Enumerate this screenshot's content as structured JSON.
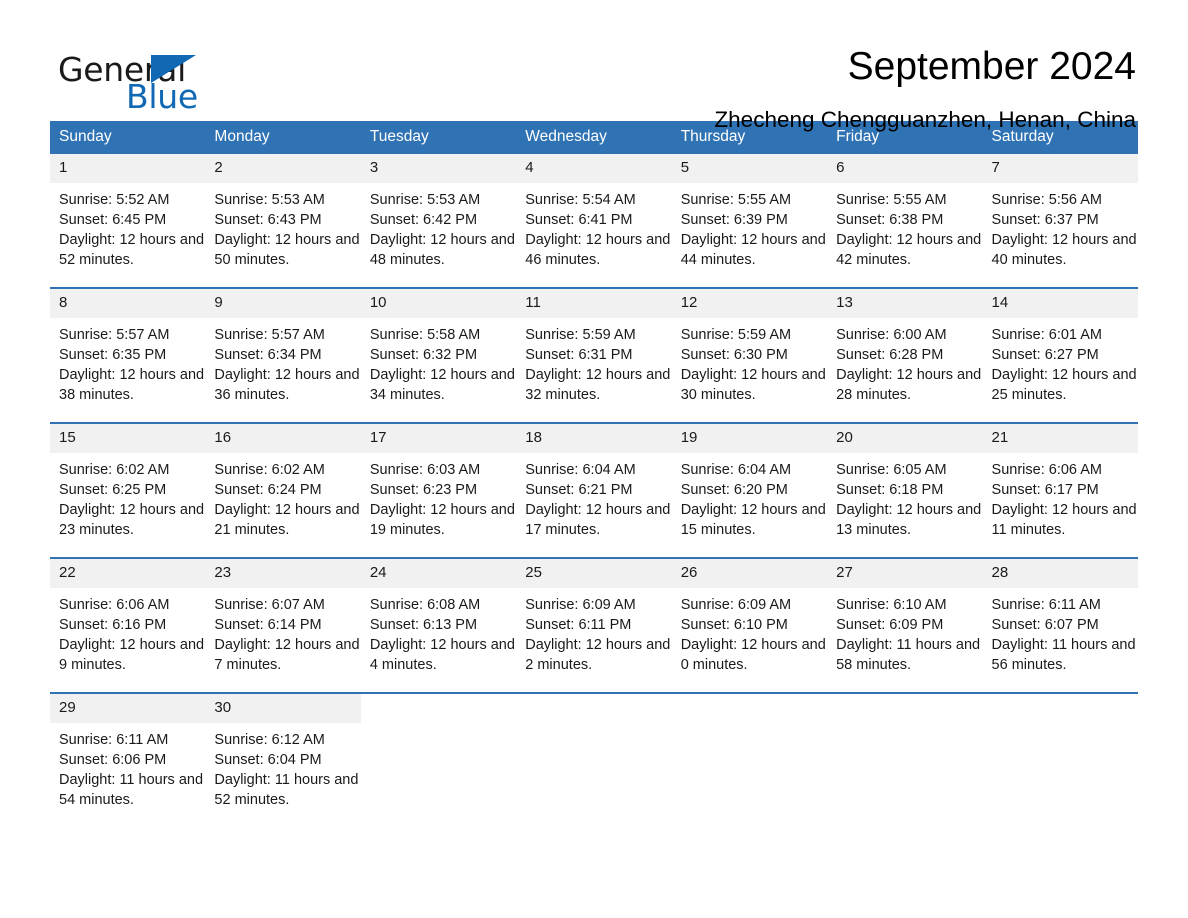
{
  "brand": {
    "name_part1": "General",
    "name_part2": "Blue",
    "accent_color": "#1168b3"
  },
  "header": {
    "title": "September 2024",
    "subtitle": "Zhecheng Chengguanzhen, Henan, China",
    "header_bg": "#3073b4",
    "daynum_bg": "#f1f1f1"
  },
  "weekdays": [
    "Sunday",
    "Monday",
    "Tuesday",
    "Wednesday",
    "Thursday",
    "Friday",
    "Saturday"
  ],
  "labels": {
    "sunrise_prefix": "Sunrise:",
    "sunset_prefix": "Sunset:",
    "daylight_prefix": "Daylight:"
  },
  "weeks": [
    [
      {
        "day": "1",
        "sunrise": "Sunrise: 5:52 AM",
        "sunset": "Sunset: 6:45 PM",
        "daylight": "Daylight: 12 hours and 52 minutes."
      },
      {
        "day": "2",
        "sunrise": "Sunrise: 5:53 AM",
        "sunset": "Sunset: 6:43 PM",
        "daylight": "Daylight: 12 hours and 50 minutes."
      },
      {
        "day": "3",
        "sunrise": "Sunrise: 5:53 AM",
        "sunset": "Sunset: 6:42 PM",
        "daylight": "Daylight: 12 hours and 48 minutes."
      },
      {
        "day": "4",
        "sunrise": "Sunrise: 5:54 AM",
        "sunset": "Sunset: 6:41 PM",
        "daylight": "Daylight: 12 hours and 46 minutes."
      },
      {
        "day": "5",
        "sunrise": "Sunrise: 5:55 AM",
        "sunset": "Sunset: 6:39 PM",
        "daylight": "Daylight: 12 hours and 44 minutes."
      },
      {
        "day": "6",
        "sunrise": "Sunrise: 5:55 AM",
        "sunset": "Sunset: 6:38 PM",
        "daylight": "Daylight: 12 hours and 42 minutes."
      },
      {
        "day": "7",
        "sunrise": "Sunrise: 5:56 AM",
        "sunset": "Sunset: 6:37 PM",
        "daylight": "Daylight: 12 hours and 40 minutes."
      }
    ],
    [
      {
        "day": "8",
        "sunrise": "Sunrise: 5:57 AM",
        "sunset": "Sunset: 6:35 PM",
        "daylight": "Daylight: 12 hours and 38 minutes."
      },
      {
        "day": "9",
        "sunrise": "Sunrise: 5:57 AM",
        "sunset": "Sunset: 6:34 PM",
        "daylight": "Daylight: 12 hours and 36 minutes."
      },
      {
        "day": "10",
        "sunrise": "Sunrise: 5:58 AM",
        "sunset": "Sunset: 6:32 PM",
        "daylight": "Daylight: 12 hours and 34 minutes."
      },
      {
        "day": "11",
        "sunrise": "Sunrise: 5:59 AM",
        "sunset": "Sunset: 6:31 PM",
        "daylight": "Daylight: 12 hours and 32 minutes."
      },
      {
        "day": "12",
        "sunrise": "Sunrise: 5:59 AM",
        "sunset": "Sunset: 6:30 PM",
        "daylight": "Daylight: 12 hours and 30 minutes."
      },
      {
        "day": "13",
        "sunrise": "Sunrise: 6:00 AM",
        "sunset": "Sunset: 6:28 PM",
        "daylight": "Daylight: 12 hours and 28 minutes."
      },
      {
        "day": "14",
        "sunrise": "Sunrise: 6:01 AM",
        "sunset": "Sunset: 6:27 PM",
        "daylight": "Daylight: 12 hours and 25 minutes."
      }
    ],
    [
      {
        "day": "15",
        "sunrise": "Sunrise: 6:02 AM",
        "sunset": "Sunset: 6:25 PM",
        "daylight": "Daylight: 12 hours and 23 minutes."
      },
      {
        "day": "16",
        "sunrise": "Sunrise: 6:02 AM",
        "sunset": "Sunset: 6:24 PM",
        "daylight": "Daylight: 12 hours and 21 minutes."
      },
      {
        "day": "17",
        "sunrise": "Sunrise: 6:03 AM",
        "sunset": "Sunset: 6:23 PM",
        "daylight": "Daylight: 12 hours and 19 minutes."
      },
      {
        "day": "18",
        "sunrise": "Sunrise: 6:04 AM",
        "sunset": "Sunset: 6:21 PM",
        "daylight": "Daylight: 12 hours and 17 minutes."
      },
      {
        "day": "19",
        "sunrise": "Sunrise: 6:04 AM",
        "sunset": "Sunset: 6:20 PM",
        "daylight": "Daylight: 12 hours and 15 minutes."
      },
      {
        "day": "20",
        "sunrise": "Sunrise: 6:05 AM",
        "sunset": "Sunset: 6:18 PM",
        "daylight": "Daylight: 12 hours and 13 minutes."
      },
      {
        "day": "21",
        "sunrise": "Sunrise: 6:06 AM",
        "sunset": "Sunset: 6:17 PM",
        "daylight": "Daylight: 12 hours and 11 minutes."
      }
    ],
    [
      {
        "day": "22",
        "sunrise": "Sunrise: 6:06 AM",
        "sunset": "Sunset: 6:16 PM",
        "daylight": "Daylight: 12 hours and 9 minutes."
      },
      {
        "day": "23",
        "sunrise": "Sunrise: 6:07 AM",
        "sunset": "Sunset: 6:14 PM",
        "daylight": "Daylight: 12 hours and 7 minutes."
      },
      {
        "day": "24",
        "sunrise": "Sunrise: 6:08 AM",
        "sunset": "Sunset: 6:13 PM",
        "daylight": "Daylight: 12 hours and 4 minutes."
      },
      {
        "day": "25",
        "sunrise": "Sunrise: 6:09 AM",
        "sunset": "Sunset: 6:11 PM",
        "daylight": "Daylight: 12 hours and 2 minutes."
      },
      {
        "day": "26",
        "sunrise": "Sunrise: 6:09 AM",
        "sunset": "Sunset: 6:10 PM",
        "daylight": "Daylight: 12 hours and 0 minutes."
      },
      {
        "day": "27",
        "sunrise": "Sunrise: 6:10 AM",
        "sunset": "Sunset: 6:09 PM",
        "daylight": "Daylight: 11 hours and 58 minutes."
      },
      {
        "day": "28",
        "sunrise": "Sunrise: 6:11 AM",
        "sunset": "Sunset: 6:07 PM",
        "daylight": "Daylight: 11 hours and 56 minutes."
      }
    ],
    [
      {
        "day": "29",
        "sunrise": "Sunrise: 6:11 AM",
        "sunset": "Sunset: 6:06 PM",
        "daylight": "Daylight: 11 hours and 54 minutes."
      },
      {
        "day": "30",
        "sunrise": "Sunrise: 6:12 AM",
        "sunset": "Sunset: 6:04 PM",
        "daylight": "Daylight: 11 hours and 52 minutes."
      },
      {
        "day": "",
        "sunrise": "",
        "sunset": "",
        "daylight": ""
      },
      {
        "day": "",
        "sunrise": "",
        "sunset": "",
        "daylight": ""
      },
      {
        "day": "",
        "sunrise": "",
        "sunset": "",
        "daylight": ""
      },
      {
        "day": "",
        "sunrise": "",
        "sunset": "",
        "daylight": ""
      },
      {
        "day": "",
        "sunrise": "",
        "sunset": "",
        "daylight": ""
      }
    ]
  ]
}
